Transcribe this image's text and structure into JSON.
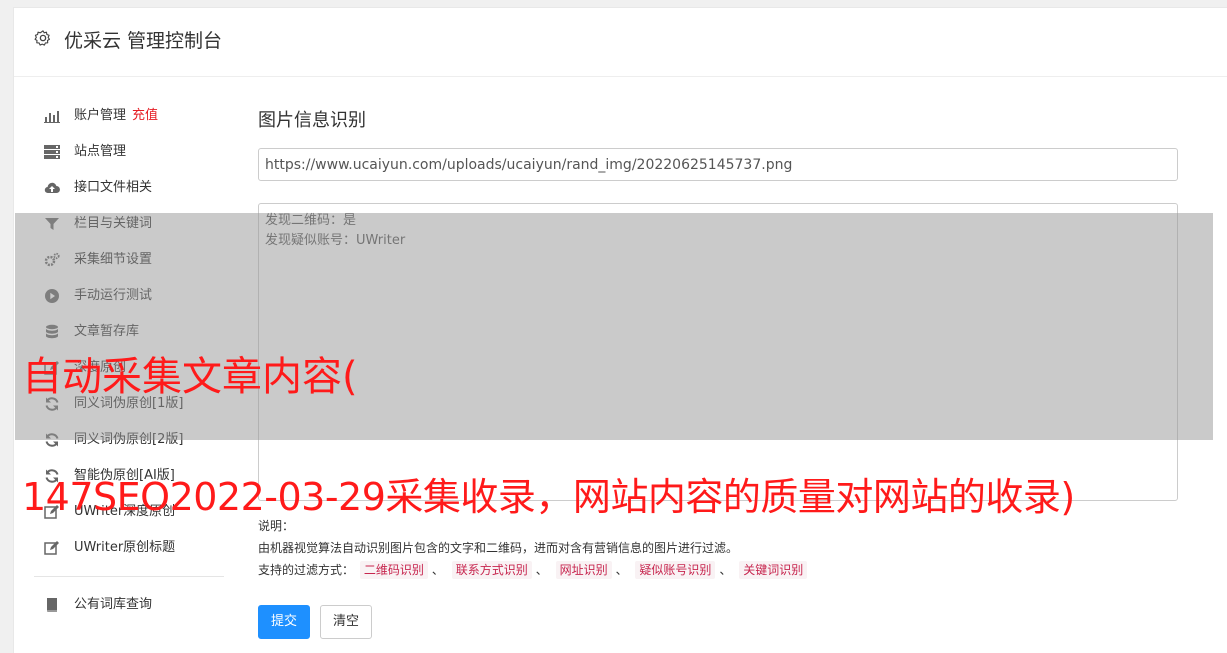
{
  "header": {
    "title": "优采云 管理控制台",
    "icon": "gear-icon"
  },
  "sidebar": {
    "items": [
      {
        "label": "账户管理",
        "tag": "充值",
        "icon": "bar-chart-icon"
      },
      {
        "label": "站点管理",
        "icon": "server-icon"
      },
      {
        "label": "接口文件相关",
        "icon": "cloud-upload-icon"
      },
      {
        "label": "栏目与关键词",
        "icon": "filter-icon"
      },
      {
        "label": "采集细节设置",
        "icon": "gears-icon"
      },
      {
        "label": "手动运行测试",
        "icon": "play-circle-icon"
      },
      {
        "label": "文章暂存库",
        "icon": "database-icon"
      },
      {
        "label": "深度原创",
        "icon": "edit-icon"
      },
      {
        "label": "同义词伪原创[1版]",
        "icon": "refresh-icon"
      },
      {
        "label": "同义词伪原创[2版]",
        "icon": "refresh-icon"
      },
      {
        "label": "智能伪原创[AI版]",
        "icon": "refresh-icon"
      },
      {
        "label": "UWriter深度原创",
        "icon": "edit-icon"
      },
      {
        "label": "UWriter原创标题",
        "icon": "edit-icon"
      }
    ],
    "bottom_items": [
      {
        "label": "公有词库查询",
        "icon": "book-icon"
      }
    ]
  },
  "main": {
    "title": "图片信息识别",
    "url_value": "https://www.ucaiyun.com/uploads/ucaiyun/rand_img/20220625145737.png",
    "result_lines": [
      "发现二维码：是",
      "发现疑似账号：UWriter"
    ],
    "notes_label": "说明：",
    "notes_desc": "由机器视觉算法自动识别图片包含的文字和二维码，进而对含有营销信息的图片进行过滤。",
    "filter_label": "支持的过滤方式：",
    "filters": [
      "二维码识别",
      "联系方式识别",
      "网址识别",
      "疑似账号识别",
      "关键词识别"
    ],
    "filter_sep": "、",
    "submit_label": "提交",
    "clear_label": "清空"
  },
  "overlay": {
    "line1": "自动采集文章内容(",
    "line2": "147SEO2022-03-29采集收录，网站内容的质量对网站的收录)"
  },
  "colors": {
    "primary": "#1e90ff",
    "tag_red": "#e51c23",
    "chip_text": "#c7254e",
    "chip_bg": "#f9f2f4",
    "overlay_text": "#ff1a1a"
  }
}
